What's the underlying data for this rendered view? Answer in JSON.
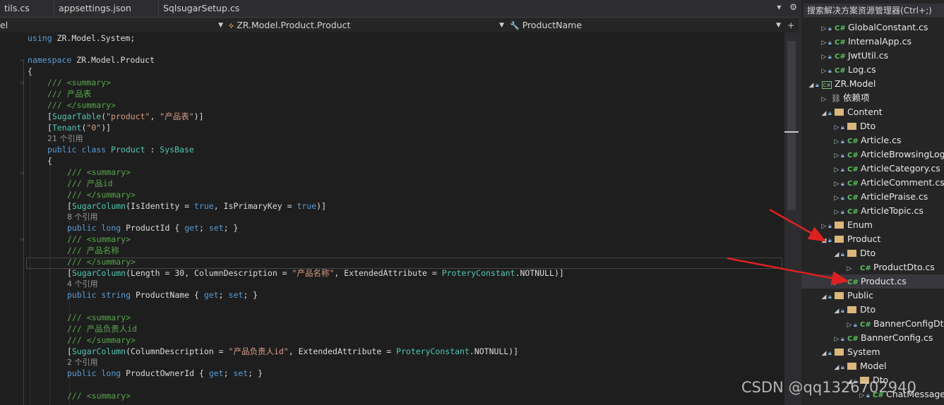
{
  "tabs": [
    "tils.cs",
    "appsettings.json",
    "SqlsugarSetup.cs"
  ],
  "tab_tools": {
    "overflow": "▾",
    "settings": "⚙"
  },
  "nav": {
    "project": "el",
    "type": "ZR.Model.Product.Product",
    "member": "ProductName",
    "add": "+"
  },
  "code_lines": [
    {
      "t": "using",
      "i": 0,
      "parts": [
        [
          "kw",
          "using"
        ],
        [
          "",
          "ZR.Model.System;"
        ]
      ]
    }
  ],
  "code": {
    "l1_kw": "using",
    "l1_rest": " ZR.Model.System;",
    "l3_kw": "namespace",
    "l3_rest": " ZR.Model.Product",
    "l4": "{",
    "c1": "/// <summary>",
    "c2": "/// 产品表",
    "c3": "/// </summary>",
    "a1a": "[",
    "a1b": "SugarTable",
    "a1c": "(",
    "a1d": "\"product\"",
    "a1e": ", ",
    "a1f": "\"产品表\"",
    "a1g": ")]",
    "a2a": "[",
    "a2b": "Tenant",
    "a2c": "(",
    "a2d": "\"0\"",
    "a2e": ")]",
    "ref1": "21 个引用",
    "cls_kw1": "public",
    "cls_kw2": "class",
    "cls_name": "Product",
    "cls_colon": " : ",
    "cls_base": "SysBase",
    "ob2": "{",
    "p1c1": "/// <summary>",
    "p1c2": "/// 产品id",
    "p1c3": "/// </summary>",
    "p1a1": "[",
    "p1a2": "SugarColumn",
    "p1a3": "(IsIdentity = ",
    "p1a4": "true",
    "p1a5": ", IsPrimaryKey = ",
    "p1a6": "true",
    "p1a7": ")]",
    "ref2": "8 个引用",
    "p1kw1": "public",
    "p1kw2": "long",
    "p1name": " ProductId { ",
    "p1get": "get",
    "p1semi": "; ",
    "p1set": "set",
    "p1end": "; }",
    "p2c1": "/// <summary>",
    "p2c2": "/// 产品名称",
    "p2c3": "/// </summary>",
    "p2a1": "[",
    "p2a2": "SugarColumn",
    "p2a3": "(Length = 30, ColumnDescription = ",
    "p2a4": "\"产品名称\"",
    "p2a5": ", ExtendedAttribute = ",
    "p2a6": "ProteryConstant",
    "p2a7": ".NOTNULL)]",
    "ref3": "4 个引用",
    "p2kw1": "public",
    "p2kw2": "string",
    "p2name": " ProductName { ",
    "p2get": "get",
    "p2semi": "; ",
    "p2set": "set",
    "p2end": "; }",
    "p3c1": "/// <summary>",
    "p3c2": "/// 产品负责人id",
    "p3c3": "/// </summary>",
    "p3a1": "[",
    "p3a2": "SugarColumn",
    "p3a3": "(ColumnDescription = ",
    "p3a4": "\"产品负责人id\"",
    "p3a5": ", ExtendedAttribute = ",
    "p3a6": "ProteryConstant",
    "p3a7": ".NOTNULL)]",
    "ref4": "2 个引用",
    "p3kw1": "public",
    "p3kw2": "long",
    "p3name": " ProductOwnerId { ",
    "p3get": "get",
    "p3semi": "; ",
    "p3set": "set",
    "p3end": "; }",
    "p4c1": "/// <summary>"
  },
  "explorer": {
    "search": "搜索解决方案资源管理器(Ctrl+;)",
    "items": [
      {
        "label": "GlobalConstant.cs"
      },
      {
        "label": "InternalApp.cs"
      },
      {
        "label": "JwtUtil.cs"
      },
      {
        "label": "Log.cs"
      },
      {
        "label": "ZR.Model"
      },
      {
        "label": "依赖项"
      },
      {
        "label": "Content"
      },
      {
        "label": "Dto"
      },
      {
        "label": "Article.cs"
      },
      {
        "label": "ArticleBrowsingLog"
      },
      {
        "label": "ArticleCategory.cs"
      },
      {
        "label": "ArticleComment.cs"
      },
      {
        "label": "ArticlePraise.cs"
      },
      {
        "label": "ArticleTopic.cs"
      },
      {
        "label": "Enum"
      },
      {
        "label": "Product"
      },
      {
        "label": "Dto"
      },
      {
        "label": "ProductDto.cs"
      },
      {
        "label": "Product.cs"
      },
      {
        "label": "Public"
      },
      {
        "label": "Dto"
      },
      {
        "label": "BannerConfigDto"
      },
      {
        "label": "BannerConfig.cs"
      },
      {
        "label": "System"
      },
      {
        "label": "Model"
      },
      {
        "label": "Dto"
      },
      {
        "label": "ChatMessage"
      }
    ],
    "cs_glyph": "C#",
    "proj_glyph": "C#"
  },
  "watermark": "CSDN @qq1326702940",
  "colors": {
    "arrow": "#e02020",
    "keyword": "#569cd6",
    "comment": "#57a64a",
    "type": "#4ec9b0",
    "string": "#d69d85"
  }
}
